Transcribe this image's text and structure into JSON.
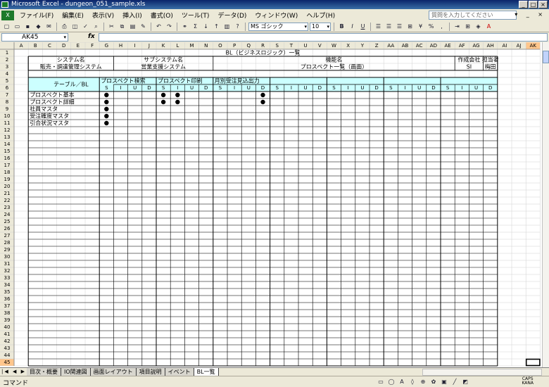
{
  "window": {
    "title": "Microsoft Excel - dungeon_051_sample.xls"
  },
  "menu": {
    "items": [
      "ファイル(F)",
      "編集(E)",
      "表示(V)",
      "挿入(I)",
      "書式(O)",
      "ツール(T)",
      "データ(D)",
      "ウィンドウ(W)",
      "ヘルプ(H)"
    ],
    "help_placeholder": "質問を入力してください"
  },
  "toolbar": {
    "font": "MS ゴシック",
    "size": "10"
  },
  "formula": {
    "namebox": "AK45",
    "fx": "fx"
  },
  "columns": [
    "A",
    "B",
    "C",
    "D",
    "E",
    "F",
    "G",
    "H",
    "I",
    "J",
    "K",
    "L",
    "M",
    "N",
    "O",
    "P",
    "Q",
    "R",
    "S",
    "T",
    "U",
    "V",
    "W",
    "X",
    "Y",
    "Z",
    "AA",
    "AB",
    "AC",
    "AD",
    "AE",
    "AF",
    "AG",
    "AH",
    "AI",
    "AJ",
    "AK"
  ],
  "rows": 45,
  "sheet": {
    "title": "BL（ビジネスロジック）一覧",
    "system_label": "システム名",
    "system_value": "販売・調達管理システム",
    "subsystem_label": "サブシステム名",
    "subsystem_value": "営業支援システム",
    "function_label": "機能名",
    "function_value": "プロスペクト一覧（画面）",
    "company_label": "作成会社",
    "company_value": "SI",
    "owner_label": "担当者",
    "owner_value": "梅田",
    "table_bl_label": "テーブル／BL",
    "groups": [
      "プロスペクト検索",
      "プロスペクト印刷",
      "月別受注見込出力"
    ],
    "siud": [
      "S",
      "I",
      "U",
      "D"
    ],
    "tables": [
      "プロスペクト基本",
      "プロスペクト詳細",
      "社員マスタ",
      "受注確度マスタ",
      "引合状況マスタ"
    ],
    "marks": [
      {
        "row": 0,
        "col": "S",
        "group": 0
      },
      {
        "row": 0,
        "col": "S",
        "group": 1
      },
      {
        "row": 0,
        "col": "I",
        "group": 1
      },
      {
        "row": 0,
        "col": "D",
        "group": 2
      },
      {
        "row": 1,
        "col": "S",
        "group": 0
      },
      {
        "row": 1,
        "col": "S",
        "group": 1
      },
      {
        "row": 1,
        "col": "I",
        "group": 1
      },
      {
        "row": 1,
        "col": "D",
        "group": 2
      },
      {
        "row": 2,
        "col": "S",
        "group": 0
      },
      {
        "row": 3,
        "col": "S",
        "group": 0
      },
      {
        "row": 4,
        "col": "S",
        "group": 0
      }
    ]
  },
  "tabs": [
    "目次・概要",
    "IO関連図",
    "画面レイアウト",
    "項目説明",
    "イベント",
    "BL一覧"
  ],
  "active_tab": "BL一覧",
  "status": "コマンド",
  "status_right": {
    "caps": "CAPS",
    "kana": "KANA"
  }
}
